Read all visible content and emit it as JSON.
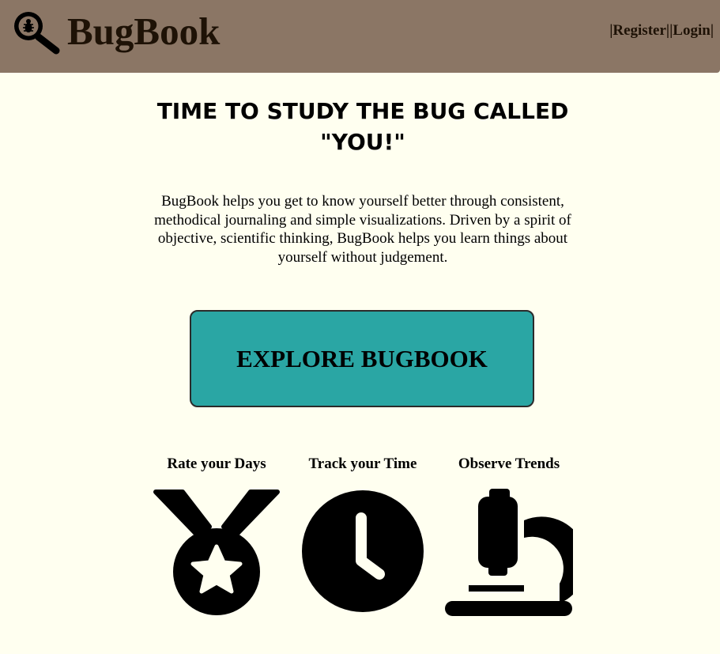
{
  "header": {
    "brand": "BugBook",
    "register_label": "Register",
    "login_label": "Login",
    "separator": "|",
    "logo_icon": "magnifier-bug-icon",
    "background": "#8b7665"
  },
  "hero": {
    "title_line1": "TIME TO STUDY THE BUG CALLED",
    "title_line2": "\"YOU!\"",
    "intro": "BugBook helps you get to know yourself better through consistent, methodical journaling and simple visualizations. Driven by a spirit of objective, scientific thinking, BugBook helps you learn things about yourself without judgement."
  },
  "cta": {
    "label": "EXPLORE BUGBOOK",
    "color": "#2aa6a4"
  },
  "features": [
    {
      "title": "Rate your Days",
      "icon": "medal-icon"
    },
    {
      "title": "Track your Time",
      "icon": "clock-icon"
    },
    {
      "title": "Observe Trends",
      "icon": "microscope-icon"
    }
  ],
  "colors": {
    "page_background": "#fffff0",
    "header_text": "#1e1206"
  }
}
